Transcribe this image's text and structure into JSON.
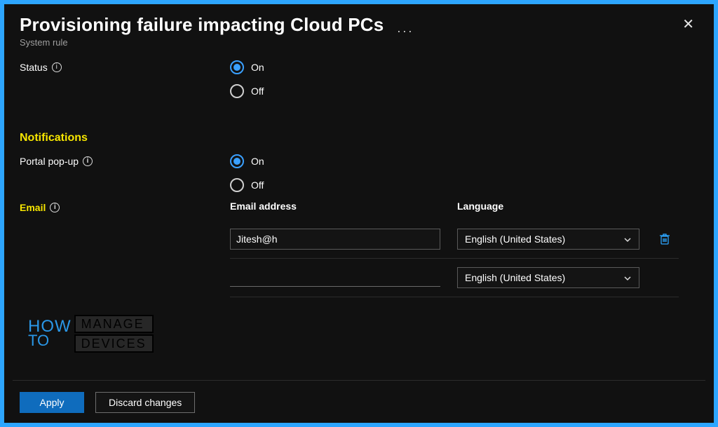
{
  "header": {
    "title": "Provisioning failure impacting Cloud PCs",
    "subtitle": "System rule",
    "ellipsis": "···"
  },
  "status": {
    "label": "Status",
    "options": {
      "on": "On",
      "off": "Off"
    },
    "selected": "on"
  },
  "sections": {
    "notifications": "Notifications"
  },
  "portal": {
    "label": "Portal pop-up",
    "options": {
      "on": "On",
      "off": "Off"
    },
    "selected": "on"
  },
  "email": {
    "label": "Email",
    "columns": {
      "address": "Email address",
      "language": "Language"
    },
    "rows": [
      {
        "address": "Jitesh@h",
        "language": "English (United States)",
        "removable": true
      },
      {
        "address": "",
        "language": "English (United States)",
        "removable": false
      }
    ]
  },
  "footer": {
    "apply": "Apply",
    "discard": "Discard changes"
  },
  "watermark": {
    "how": "HOW",
    "to": "TO",
    "line1": "MANAGE",
    "line2": "DEVICES"
  }
}
